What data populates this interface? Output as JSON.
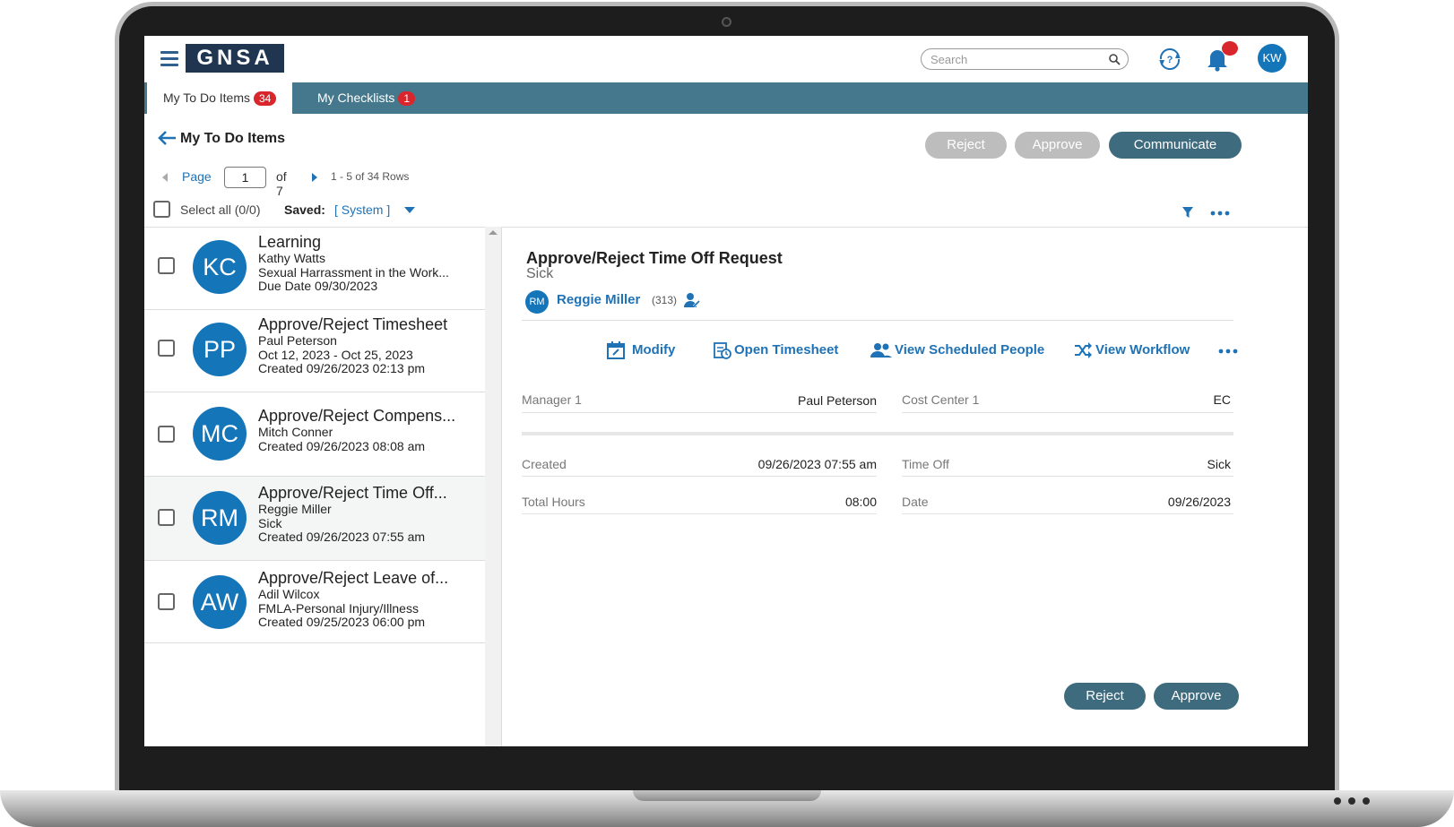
{
  "app": {
    "logo": "GNSA",
    "search_placeholder": "Search",
    "user_initials": "KW"
  },
  "tabs": [
    {
      "label": "My To Do Items",
      "count": "34"
    },
    {
      "label": "My Checklists",
      "count": "1"
    }
  ],
  "toolbar": {
    "title": "My To Do Items",
    "reject": "Reject",
    "approve": "Approve",
    "communicate": "Communicate"
  },
  "pager": {
    "label": "Page",
    "page": "1",
    "of": "of 7",
    "rows": "1 - 5 of 34 Rows"
  },
  "selection": {
    "select_all": "Select all (0/0)",
    "saved_label": "Saved:",
    "saved_value": "[ System ]"
  },
  "items": [
    {
      "initials": "KC",
      "title": "Learning",
      "lines": [
        "Kathy Watts",
        "Sexual Harrassment in the Work...",
        "Due Date 09/30/2023"
      ]
    },
    {
      "initials": "PP",
      "title": "Approve/Reject Timesheet",
      "lines": [
        "Paul Peterson",
        "Oct 12, 2023 - Oct 25, 2023",
        "Created 09/26/2023 02:13 pm"
      ]
    },
    {
      "initials": "MC",
      "title": "Approve/Reject Compens...",
      "lines": [
        "Mitch Conner",
        "Created 09/26/2023 08:08 am"
      ]
    },
    {
      "initials": "RM",
      "title": "Approve/Reject Time Off...",
      "lines": [
        "Reggie Miller",
        "Sick",
        "Created 09/26/2023 07:55 am"
      ]
    },
    {
      "initials": "AW",
      "title": "Approve/Reject Leave of...",
      "lines": [
        "Adil Wilcox",
        "FMLA-Personal Injury/Illness",
        "Created 09/25/2023 06:00 pm"
      ]
    }
  ],
  "detail": {
    "title": "Approve/Reject Time Off Request",
    "subtitle": "Sick",
    "person_initials": "RM",
    "person_name": "Reggie Miller",
    "person_id": "(313)",
    "actions": {
      "modify": "Modify",
      "open_timesheet": "Open Timesheet",
      "view_scheduled_people": "View Scheduled People",
      "view_workflow": "View Workflow"
    },
    "fields": {
      "manager_label": "Manager 1",
      "manager_value": "Paul Peterson",
      "cost_center_label": "Cost Center 1",
      "cost_center_value": "EC",
      "created_label": "Created",
      "created_value": "09/26/2023 07:55 am",
      "time_off_label": "Time Off",
      "time_off_value": "Sick",
      "total_hours_label": "Total Hours",
      "total_hours_value": "08:00",
      "date_label": "Date",
      "date_value": "09/26/2023"
    },
    "reject": "Reject",
    "approve": "Approve"
  },
  "colors": {
    "tab_bar": "#45788c",
    "primary_button": "#3f6b7f",
    "avatar": "#1475b9",
    "link": "#1f72b5",
    "badge": "#d9262c"
  }
}
